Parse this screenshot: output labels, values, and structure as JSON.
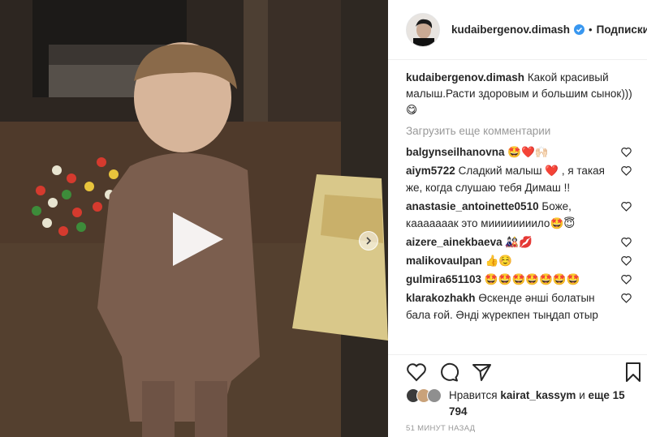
{
  "post": {
    "username": "kudaibergenov.dimash",
    "follow_label": "Подписки",
    "separator": "•",
    "caption_text": "Какой красивый малыш.Расти здоровым и большим сынок)))😋",
    "load_more_label": "Загрузить еще комментарии",
    "timestamp": "51 МИНУТ НАЗАД"
  },
  "comments": [
    {
      "user": "balgynseilhanovna",
      "text": "🤩❤️🙌🏻"
    },
    {
      "user": "aiym5722",
      "text": "Сладкий малыш ❤️ , я такая же, когда слушаю тебя Димаш !!"
    },
    {
      "user": "anastasie_antoinette0510",
      "text": "Боже, кааааааак это миииииииило🤩😇"
    },
    {
      "user": "aizere_ainekbaeva",
      "text": "🎎💋"
    },
    {
      "user": "malikovaulpan",
      "text": "👍☺️"
    },
    {
      "user": "gulmira651103",
      "text": "🤩🤩🤩🤩🤩🤩🤩"
    },
    {
      "user": "klarakozhakh",
      "text": "Өскенде әнші болатын бала ғой. Әнді жүрекпен тыңдап отыр"
    }
  ],
  "likes": {
    "prefix": "Нравится",
    "user": "kairat_kassym",
    "conj": "и",
    "others": "еще 15 794"
  },
  "icons": {
    "play": "play-icon",
    "next": "chevron-right-icon",
    "verified": "verified-badge-icon",
    "like": "heart-icon",
    "comment": "comment-icon",
    "share": "share-icon",
    "save": "bookmark-icon"
  },
  "colors": {
    "verified": "#3897f0",
    "muted_text": "#999999",
    "text": "#262626"
  }
}
